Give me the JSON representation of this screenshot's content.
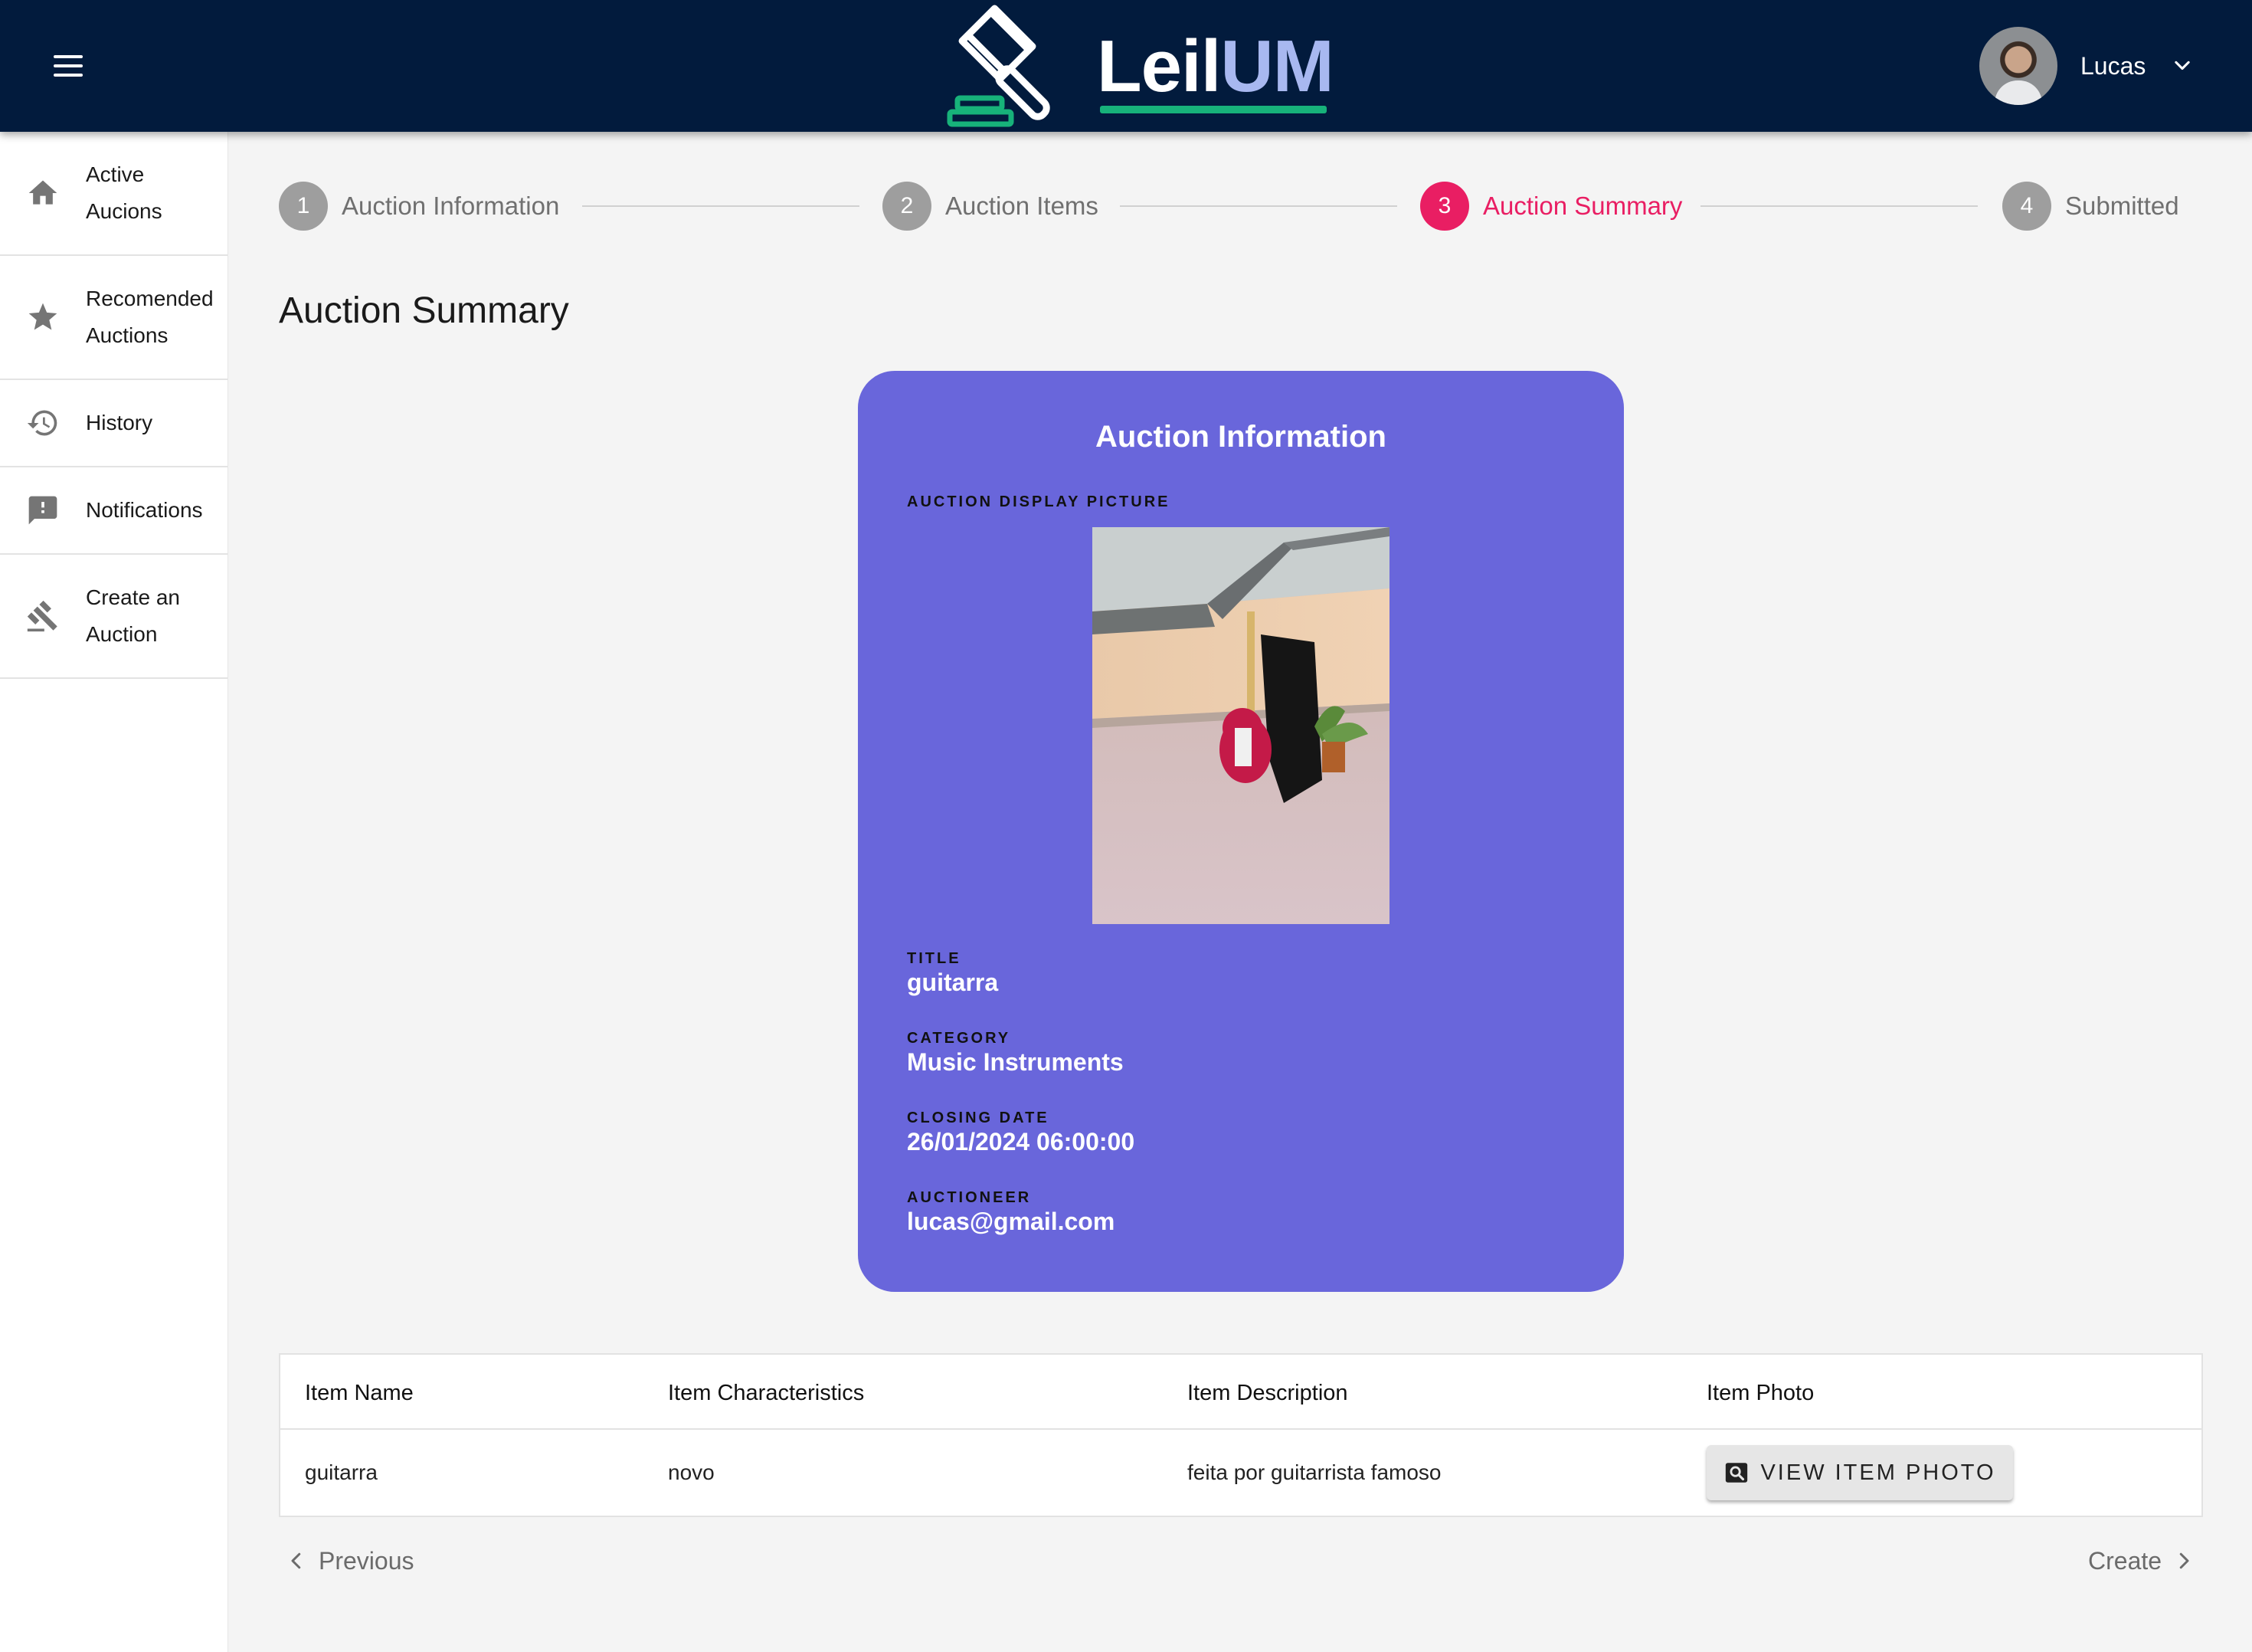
{
  "header": {
    "logo_text_a": "Leil",
    "logo_text_b": "UM",
    "user_name": "Lucas"
  },
  "sidebar": {
    "items": [
      {
        "label": "Active Aucions",
        "icon": "home-icon"
      },
      {
        "label": "Recomended Auctions",
        "icon": "star-icon"
      },
      {
        "label": "History",
        "icon": "history-icon"
      },
      {
        "label": "Notifications",
        "icon": "feedback-icon"
      },
      {
        "label": "Create an Auction",
        "icon": "gavel-icon"
      }
    ]
  },
  "stepper": {
    "steps": [
      {
        "number": "1",
        "label": "Auction Information"
      },
      {
        "number": "2",
        "label": "Auction Items"
      },
      {
        "number": "3",
        "label": "Auction Summary"
      },
      {
        "number": "4",
        "label": "Submitted"
      }
    ],
    "active_step": 3
  },
  "main": {
    "title": "Auction Summary",
    "card": {
      "title": "Auction Information",
      "display_picture_label": "Auction Display Picture",
      "fields": [
        {
          "label": "Title",
          "value": "guitarra"
        },
        {
          "label": "Category",
          "value": "Music Instruments"
        },
        {
          "label": "Closing Date",
          "value": "26/01/2024 06:00:00"
        },
        {
          "label": "Auctioneer",
          "value": "lucas@gmail.com"
        }
      ]
    },
    "table": {
      "headers": [
        "Item Name",
        "Item Characteristics",
        "Item Description",
        "Item Photo"
      ],
      "rows": [
        {
          "name": "guitarra",
          "characteristics": "novo",
          "description": "feita por guitarrista famoso",
          "photo_button": "VIEW ITEM PHOTO"
        }
      ]
    },
    "nav": {
      "previous_label": "Previous",
      "next_label": "Create"
    }
  },
  "colors": {
    "topbar": "#021b3d",
    "accent_active": "#e91e63",
    "card": "#6966db",
    "logo_green": "#17b27a"
  }
}
